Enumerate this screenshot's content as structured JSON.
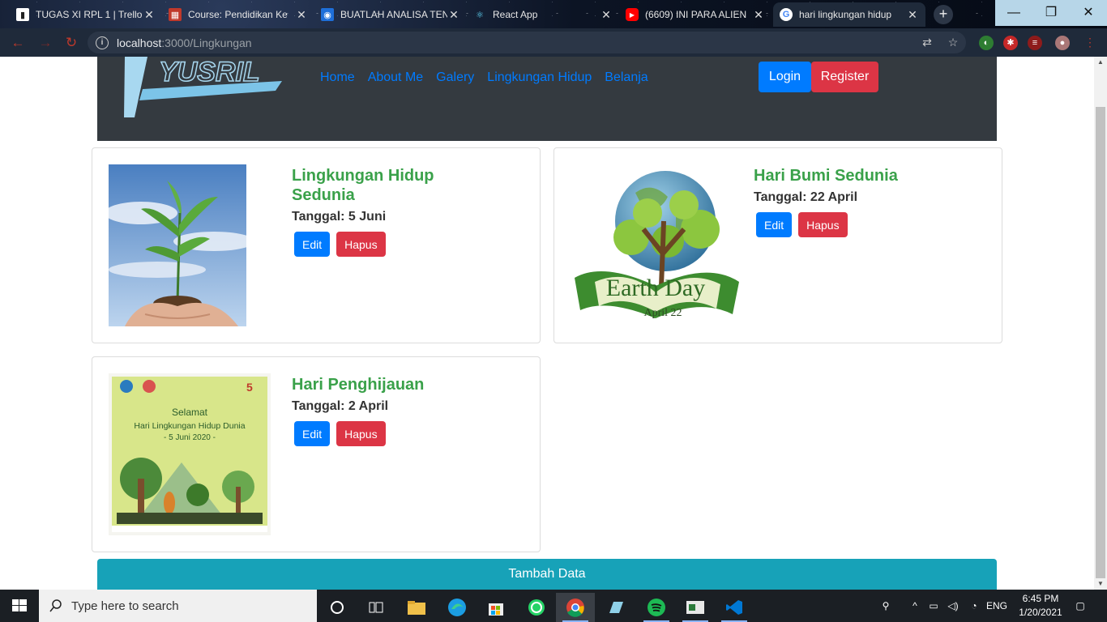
{
  "browser": {
    "tabs": [
      {
        "title": "TUGAS XI RPL 1 | Trello",
        "icon": "trello-icon"
      },
      {
        "title": "Course: Pendidikan Ke",
        "icon": "moodle-icon"
      },
      {
        "title": "BUATLAH ANALISA TEN",
        "icon": "classroom-icon"
      },
      {
        "title": "React App",
        "icon": "react-icon"
      },
      {
        "title": "(6609) INI PARA ALIEN",
        "icon": "youtube-icon"
      },
      {
        "title": "hari lingkungan hidup",
        "icon": "google-icon"
      }
    ],
    "url_host": "localhost",
    "url_rest": ":3000/Lingkungan"
  },
  "site": {
    "logo_text": "YUSRIL",
    "menu": [
      "Home",
      "About Me",
      "Galery",
      "Lingkungan Hidup",
      "Belanja"
    ],
    "login_label": "Login",
    "register_label": "Register"
  },
  "cards": [
    {
      "title": "Lingkungan Hidup Sedunia",
      "date": "Tanggal: 5 Juni",
      "edit": "Edit",
      "delete": "Hapus"
    },
    {
      "title": "Hari Bumi Sedunia",
      "date": "Tanggal: 22 April",
      "edit": "Edit",
      "delete": "Hapus",
      "image_text": "Earth Day",
      "image_subtext": "April 22"
    },
    {
      "title": "Hari Penghijauan",
      "date": "Tanggal: 2 April",
      "edit": "Edit",
      "delete": "Hapus",
      "image_text": "Selamat",
      "image_text2": "Hari Lingkungan Hidup Dunia",
      "image_text3": "- 5 Juni 2020 -"
    }
  ],
  "add_button": "Tambah Data",
  "taskbar": {
    "search_placeholder": "Type here to search",
    "language": "ENG",
    "time": "6:45 PM",
    "date": "1/20/2021"
  },
  "colors": {
    "header": "#343a40",
    "primary": "#007bff",
    "danger": "#dc3545",
    "info": "#17a2b8",
    "title_green": "#3aa14a"
  }
}
